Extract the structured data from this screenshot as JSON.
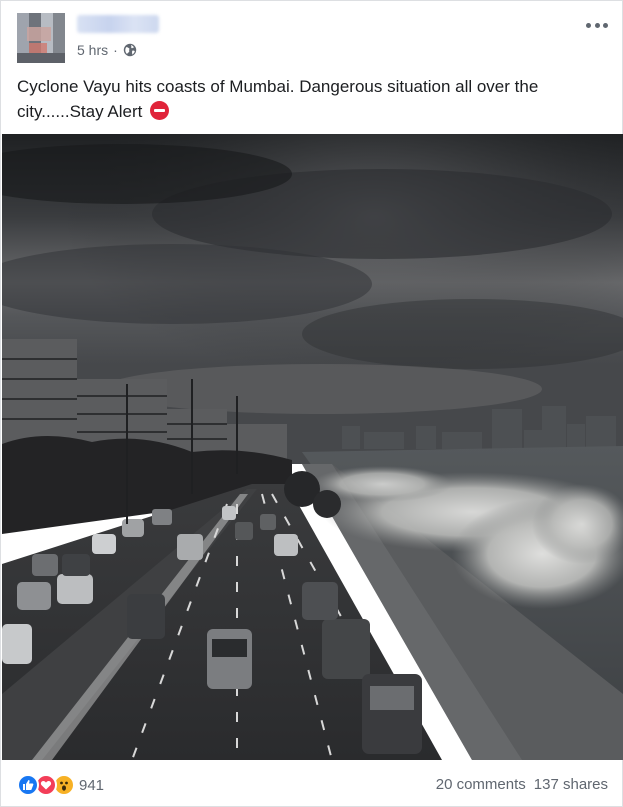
{
  "post": {
    "timestamp": "5 hrs",
    "separator": "·",
    "privacy_icon": "public-globe-icon",
    "more_icon": "more-options-icon",
    "text": "Cyclone Vayu hits coasts of Mumbai. Dangerous situation all over the city......Stay Alert",
    "text_emoji": "no-entry-emoji"
  },
  "reactions": {
    "icons": [
      "like-icon",
      "love-icon",
      "wow-icon"
    ],
    "count": "941",
    "comments": "20 comments",
    "shares": "137 shares"
  },
  "colors": {
    "like": "#1877f2",
    "love": "#f33e58",
    "wow": "#f7b125",
    "meta_text": "#606770",
    "body_text": "#1c1e21"
  }
}
